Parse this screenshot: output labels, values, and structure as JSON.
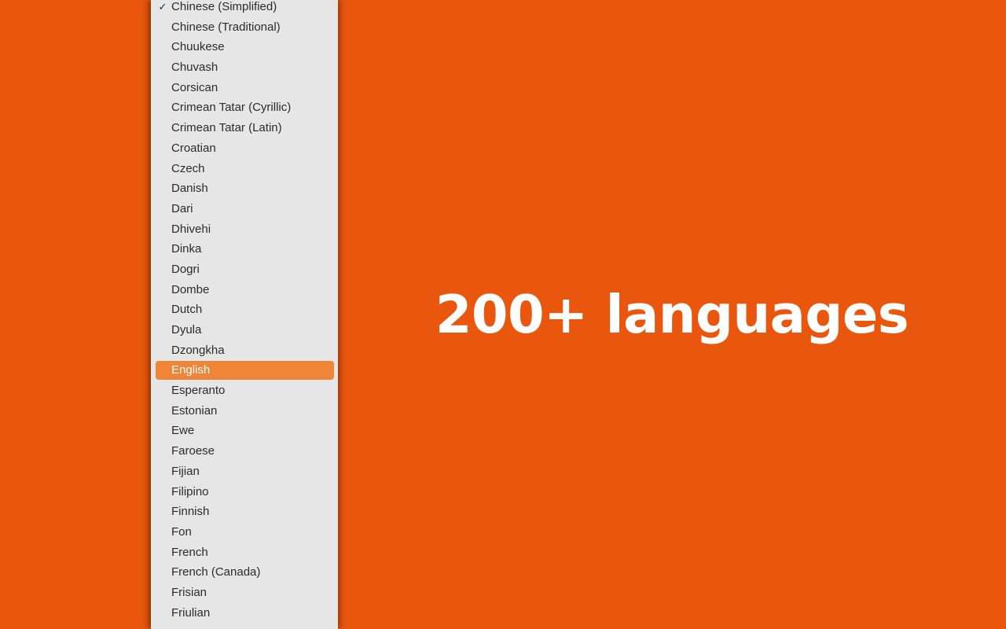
{
  "hero": {
    "title": "200+ languages"
  },
  "colors": {
    "background_orange": "#e8570d",
    "menu_background": "#e6e6e6",
    "highlight_orange": "#f08437",
    "menu_text": "#2b2b2b",
    "selected_text": "#ffffff",
    "hero_text": "#ffffff"
  },
  "language_menu": {
    "checked_item": "Chinese (Simplified)",
    "highlighted_item": "English",
    "check_glyph": "✓",
    "items": [
      {
        "label": "Chinese (Simplified)",
        "checked": true,
        "highlighted": false
      },
      {
        "label": "Chinese (Traditional)",
        "checked": false,
        "highlighted": false
      },
      {
        "label": "Chuukese",
        "checked": false,
        "highlighted": false
      },
      {
        "label": "Chuvash",
        "checked": false,
        "highlighted": false
      },
      {
        "label": "Corsican",
        "checked": false,
        "highlighted": false
      },
      {
        "label": "Crimean Tatar (Cyrillic)",
        "checked": false,
        "highlighted": false
      },
      {
        "label": "Crimean Tatar (Latin)",
        "checked": false,
        "highlighted": false
      },
      {
        "label": "Croatian",
        "checked": false,
        "highlighted": false
      },
      {
        "label": "Czech",
        "checked": false,
        "highlighted": false
      },
      {
        "label": "Danish",
        "checked": false,
        "highlighted": false
      },
      {
        "label": "Dari",
        "checked": false,
        "highlighted": false
      },
      {
        "label": "Dhivehi",
        "checked": false,
        "highlighted": false
      },
      {
        "label": "Dinka",
        "checked": false,
        "highlighted": false
      },
      {
        "label": "Dogri",
        "checked": false,
        "highlighted": false
      },
      {
        "label": "Dombe",
        "checked": false,
        "highlighted": false
      },
      {
        "label": "Dutch",
        "checked": false,
        "highlighted": false
      },
      {
        "label": "Dyula",
        "checked": false,
        "highlighted": false
      },
      {
        "label": "Dzongkha",
        "checked": false,
        "highlighted": false
      },
      {
        "label": "English",
        "checked": false,
        "highlighted": true
      },
      {
        "label": "Esperanto",
        "checked": false,
        "highlighted": false
      },
      {
        "label": "Estonian",
        "checked": false,
        "highlighted": false
      },
      {
        "label": "Ewe",
        "checked": false,
        "highlighted": false
      },
      {
        "label": "Faroese",
        "checked": false,
        "highlighted": false
      },
      {
        "label": "Fijian",
        "checked": false,
        "highlighted": false
      },
      {
        "label": "Filipino",
        "checked": false,
        "highlighted": false
      },
      {
        "label": "Finnish",
        "checked": false,
        "highlighted": false
      },
      {
        "label": "Fon",
        "checked": false,
        "highlighted": false
      },
      {
        "label": "French",
        "checked": false,
        "highlighted": false
      },
      {
        "label": "French (Canada)",
        "checked": false,
        "highlighted": false
      },
      {
        "label": "Frisian",
        "checked": false,
        "highlighted": false
      },
      {
        "label": "Friulian",
        "checked": false,
        "highlighted": false
      }
    ]
  }
}
